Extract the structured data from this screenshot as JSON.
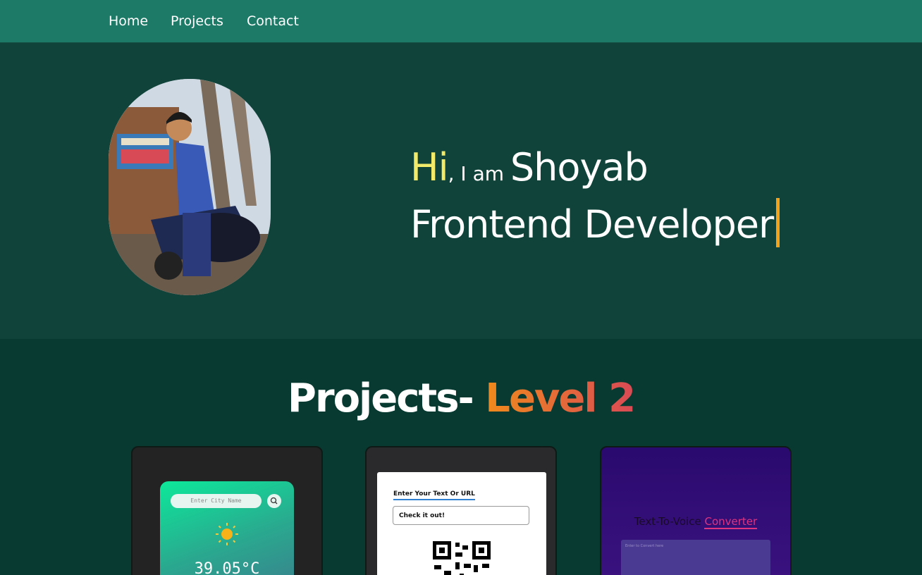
{
  "nav": {
    "home": "Home",
    "projects": "Projects",
    "contact": "Contact"
  },
  "hero": {
    "hi": "Hi",
    "iam": ", I am ",
    "name": "Shoyab",
    "role": "Frontend Developer"
  },
  "projects": {
    "title": "Projects- ",
    "level": "Level 2",
    "weather": {
      "placeholder": "Enter City Name",
      "temp": "39.05°C"
    },
    "qr": {
      "label": "Enter Your Text Or URL",
      "value": "Check it out!"
    },
    "tts": {
      "title_part1": "Text-To-Voice ",
      "title_part2": "Converter",
      "textarea_placeholder": "Enter to Convert here"
    }
  },
  "colors": {
    "nav_bg": "#1c7a66",
    "hero_bg": "#10443a",
    "section_bg": "#083a31",
    "accent_hi": "#f2ea6b",
    "caret": "#f4a21a"
  }
}
